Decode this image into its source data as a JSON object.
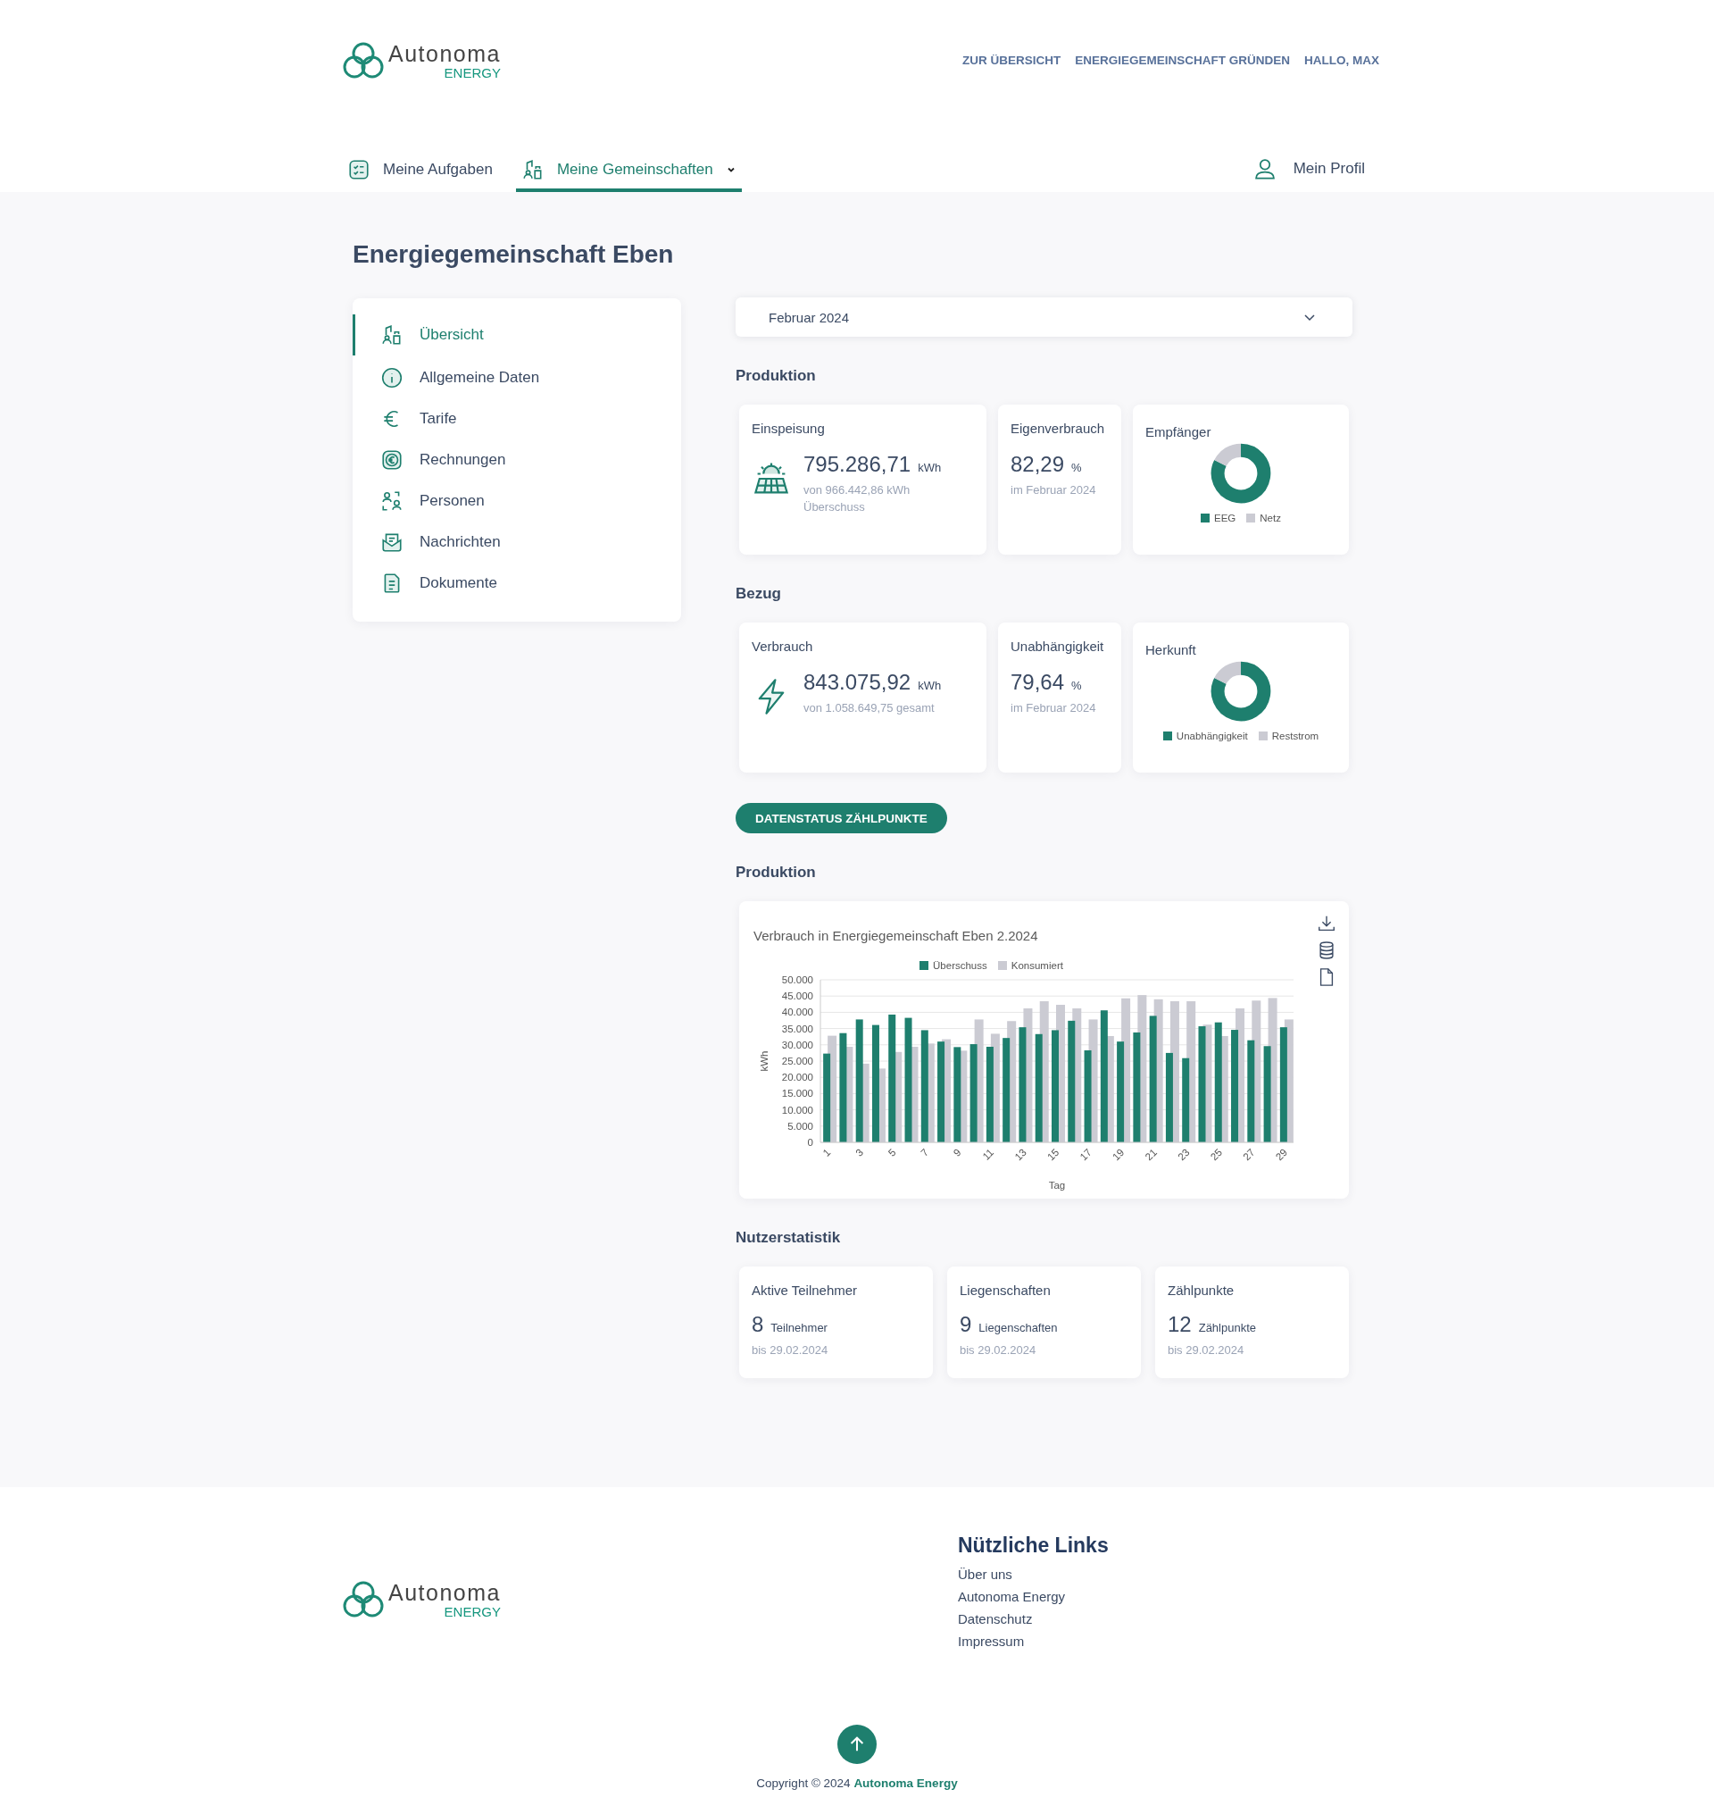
{
  "header": {
    "logo": {
      "name": "Autonoma",
      "tagline": "ENERGY"
    },
    "links": [
      "ZUR ÜBERSICHT",
      "ENERGIEGEMEINSCHAFT GRÜNDEN",
      "HALLO, MAX"
    ]
  },
  "nav": {
    "tabs": [
      {
        "label": "Meine Aufgaben",
        "selected": false,
        "kind": "tasks",
        "dropdown": false
      },
      {
        "label": "Meine Gemeinschaften",
        "selected": true,
        "kind": "community",
        "dropdown": true
      }
    ],
    "profile": "Mein Profil"
  },
  "page_title": "Energiegemeinschaft Eben",
  "sidebar": {
    "items": [
      {
        "label": "Übersicht",
        "selected": true,
        "kind": "community"
      },
      {
        "label": "Allgemeine Daten",
        "selected": false,
        "kind": "info"
      },
      {
        "label": "Tarife",
        "selected": false,
        "kind": "euro"
      },
      {
        "label": "Rechnungen",
        "selected": false,
        "kind": "invoice"
      },
      {
        "label": "Personen",
        "selected": false,
        "kind": "people"
      },
      {
        "label": "Nachrichten",
        "selected": false,
        "kind": "mail"
      },
      {
        "label": "Dokumente",
        "selected": false,
        "kind": "document"
      }
    ]
  },
  "period_select": {
    "value": "Februar 2024"
  },
  "sections": [
    {
      "title": "Produktion",
      "main": {
        "label": "Einspeisung",
        "kind": "solar",
        "value": "795.286,71",
        "unit": "kWh",
        "note": "von 966.442,86 kWh Überschuss"
      },
      "ratio": {
        "label": "Eigenverbrauch",
        "value": "82,29",
        "unit": "%",
        "note": "im Februar 2024"
      },
      "split": {
        "label": "Empfänger",
        "legend": [
          {
            "label": "EEG",
            "color": "#1e7f6e"
          },
          {
            "label": "Netz",
            "color": "#cbcbd3"
          }
        ]
      }
    },
    {
      "title": "Bezug",
      "main": {
        "label": "Verbrauch",
        "kind": "bolt",
        "value": "843.075,92",
        "unit": "kWh",
        "note": "von 1.058.649,75 gesamt"
      },
      "ratio": {
        "label": "Unabhängigkeit",
        "value": "79,64",
        "unit": "%",
        "note": "im Februar 2024"
      },
      "split": {
        "label": "Herkunft",
        "legend": [
          {
            "label": "Unabhängigkeit",
            "color": "#1e7f6e"
          },
          {
            "label": "Reststrom",
            "color": "#cbcbd3"
          }
        ]
      }
    }
  ],
  "status_button": "DATENSTATUS ZÄHLPUNKTE",
  "chart_section": {
    "title": "Produktion",
    "chart_title": "Verbrauch in Energiegemeinschaft Eben 2.2024",
    "chart_data": {
      "type": "bar",
      "xlabel": "Tag",
      "ylabel": "kWh",
      "x": [
        1,
        2,
        3,
        4,
        5,
        6,
        7,
        8,
        9,
        10,
        11,
        12,
        13,
        14,
        15,
        16,
        17,
        18,
        19,
        20,
        21,
        22,
        23,
        24,
        25,
        26,
        27,
        28,
        29
      ],
      "series": [
        {
          "name": "Überschuss",
          "color": "#1e7f6e",
          "values": [
            27300,
            33600,
            37800,
            36100,
            39300,
            38300,
            34500,
            31000,
            29300,
            30200,
            29400,
            32100,
            35400,
            33300,
            34500,
            37400,
            28300,
            40600,
            31000,
            33800,
            38900,
            27500,
            25900,
            35700,
            36900,
            34600,
            31400,
            29600,
            35400
          ]
        },
        {
          "name": "Konsumiert",
          "color": "#cbcbd3",
          "values": [
            32800,
            29400,
            24200,
            22700,
            27800,
            29400,
            30400,
            31700,
            28200,
            37800,
            33400,
            37300,
            41200,
            43400,
            42300,
            41200,
            37800,
            32700,
            44300,
            45300,
            44000,
            43400,
            43400,
            36200,
            32700,
            41200,
            43600,
            44400,
            37800
          ]
        }
      ],
      "xlim": [
        0.5,
        29.5
      ],
      "ylim": [
        0,
        50000
      ],
      "yticks": [
        {
          "value": 0,
          "label": "0"
        },
        {
          "value": 5000,
          "label": "5.000"
        },
        {
          "value": 10000,
          "label": "10.000"
        },
        {
          "value": 15000,
          "label": "15.000"
        },
        {
          "value": 20000,
          "label": "20.000"
        },
        {
          "value": 25000,
          "label": "25.000"
        },
        {
          "value": 30000,
          "label": "30.000"
        },
        {
          "value": 35000,
          "label": "35.000"
        },
        {
          "value": 40000,
          "label": "40.000"
        },
        {
          "value": 45000,
          "label": "45.000"
        },
        {
          "value": 50000,
          "label": "50.000"
        }
      ],
      "xticks": [
        1,
        3,
        5,
        7,
        9,
        11,
        13,
        15,
        17,
        19,
        21,
        23,
        25,
        27,
        29
      ],
      "stacked": false,
      "grid": true
    }
  },
  "user_stats": {
    "title": "Nutzerstatistik",
    "cards": [
      {
        "label": "Aktive Teilnehmer",
        "value": "8",
        "unit": "Teilnehmer",
        "note": "bis 29.02.2024"
      },
      {
        "label": "Liegenschaften",
        "value": "9",
        "unit": "Liegenschaften",
        "note": "bis 29.02.2024"
      },
      {
        "label": "Zählpunkte",
        "value": "12",
        "unit": "Zählpunkte",
        "note": "bis 29.02.2024"
      }
    ]
  },
  "footer": {
    "logo": {
      "name": "Autonoma",
      "tagline": "ENERGY"
    },
    "links_title": "Nützliche Links",
    "links": [
      "Über uns",
      "Autonoma Energy",
      "Datenschutz",
      "Impressum"
    ],
    "copyright": "Copyright © 2024",
    "copyright_link": "Autonoma Energy"
  }
}
